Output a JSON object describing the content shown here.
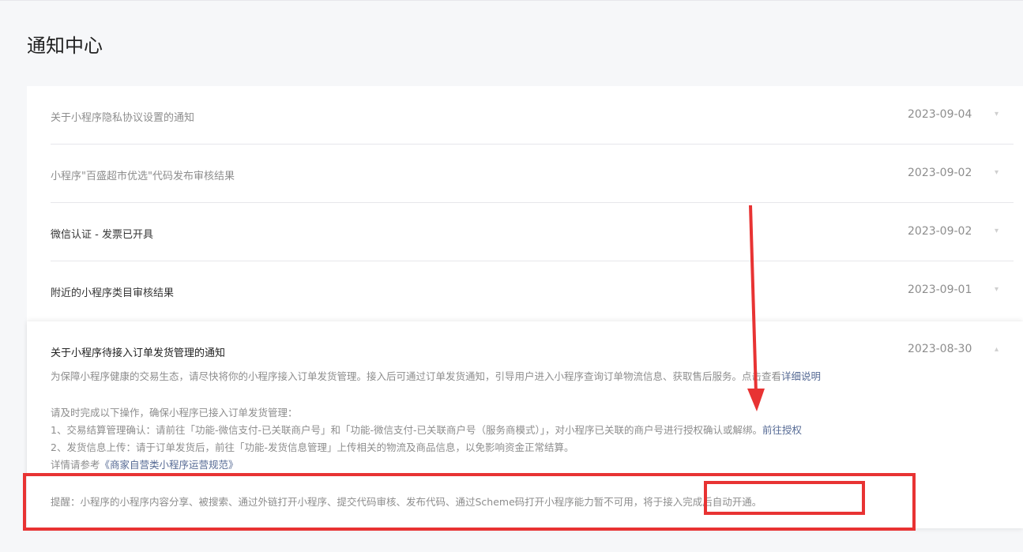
{
  "page": {
    "title": "通知中心"
  },
  "notices": [
    {
      "title": "关于小程序隐私协议设置的通知",
      "date": "2023-09-04",
      "read": true
    },
    {
      "title": "小程序\"百盛超市优选\"代码发布审核结果",
      "date": "2023-09-02",
      "read": true
    },
    {
      "title": "微信认证 - 发票已开具",
      "date": "2023-09-02",
      "read": false
    },
    {
      "title": "附近的小程序类目审核结果",
      "date": "2023-09-01",
      "read": false
    }
  ],
  "expanded": {
    "title": "关于小程序待接入订单发货管理的通知",
    "date": "2023-08-30",
    "intro": "为保障小程序健康的交易生态，请尽快将你的小程序接入订单发货管理。接入后可通过订单发货通知，引导用户进入小程序查询订单物流信息、获取售后服务。点击查看",
    "intro_link": "详细说明",
    "ops_heading": "请及时完成以下操作，确保小程序已接入订单发货管理：",
    "op1": "1、交易结算管理确认：请前往「功能-微信支付-已关联商户号」和「功能-微信支付-已关联商户号（服务商模式）」，对小程序已关联的商户号进行授权确认或解绑。",
    "op1_link": "前往授权",
    "op2": "2、发货信息上传：请于订单发货后，前往「功能-发货信息管理」上传相关的物流及商品信息，以免影响资金正常结算。",
    "ref_prefix": "详情请参考",
    "ref_link": "《商家自营类小程序运营规范》",
    "reminder": "提醒：小程序的小程序内容分享、被搜索、通过外链打开小程序、提交代码审核、发布代码、通过Scheme码打开小程序能力暂不可用，将于接入完成后自动开通。"
  },
  "colors": {
    "link": "#576b95",
    "annotation": "#e83333"
  }
}
